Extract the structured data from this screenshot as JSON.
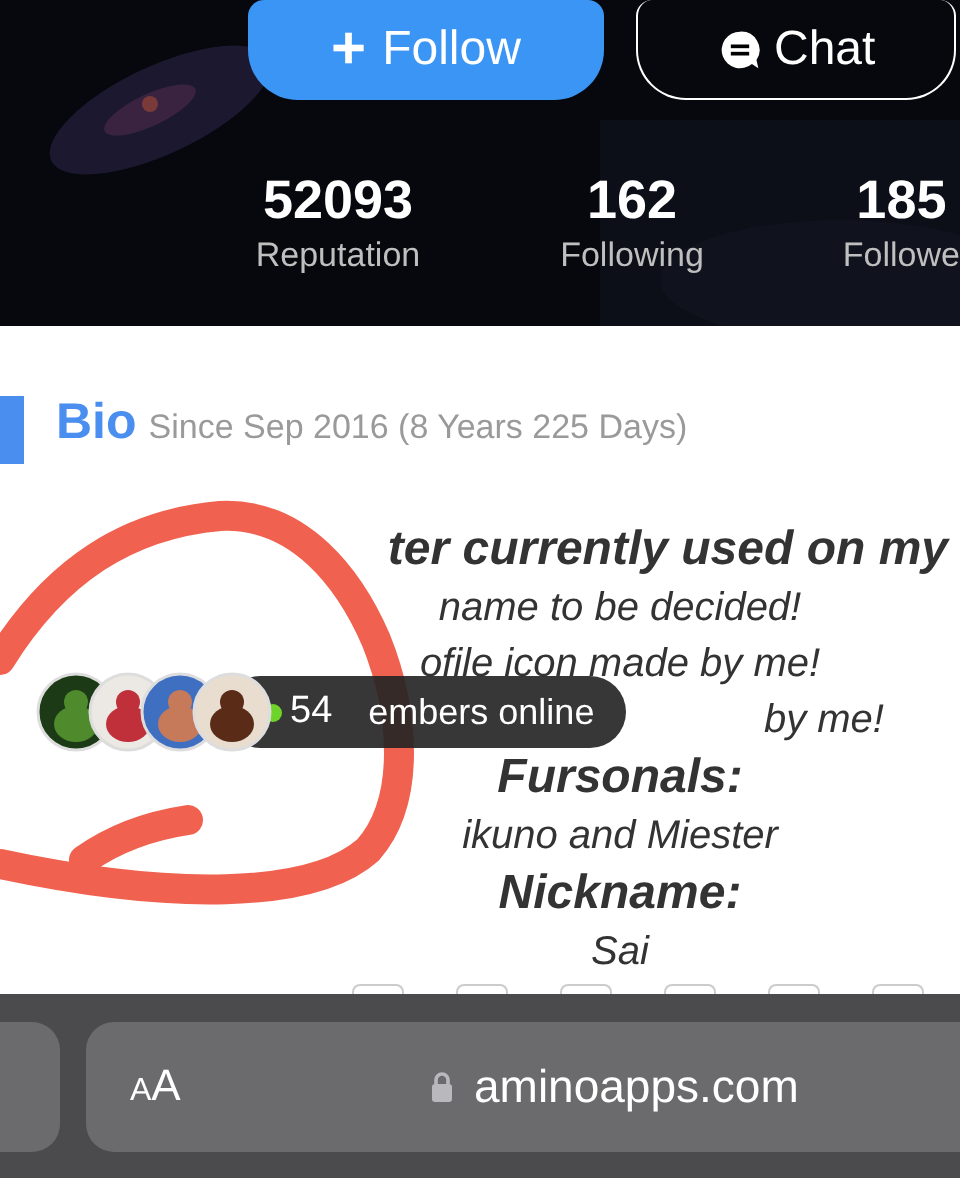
{
  "header": {
    "kind": "picture",
    "follow_button": {
      "icon": "+",
      "label": "Follow"
    },
    "chat_button": {
      "label": "Chat"
    },
    "stats": [
      {
        "value": "52093",
        "label": "Reputation"
      },
      {
        "value": "162",
        "label": "Following"
      },
      {
        "value": "185",
        "label": "Followe"
      }
    ]
  },
  "bio": {
    "title": "Bio",
    "since": "Since Sep 2016 (8 Years 225 Days)",
    "lines": [
      {
        "kind": "heading",
        "text": "ter currently used on my"
      },
      {
        "kind": "body",
        "text": "name to be decided!"
      },
      {
        "kind": "body",
        "text": "ofile icon made by me!"
      },
      {
        "kind": "tail",
        "text": "by me!"
      },
      {
        "kind": "heading",
        "text": "Fursonals:"
      },
      {
        "kind": "body",
        "text": "ikuno and Miester"
      },
      {
        "kind": "heading",
        "text": "Nickname:"
      },
      {
        "kind": "body",
        "text": "Sai"
      }
    ]
  },
  "online_bar": {
    "count": "54",
    "label": "embers online"
  },
  "browser_bar": {
    "text_size_button": "AA",
    "url": "aminoapps.com"
  }
}
